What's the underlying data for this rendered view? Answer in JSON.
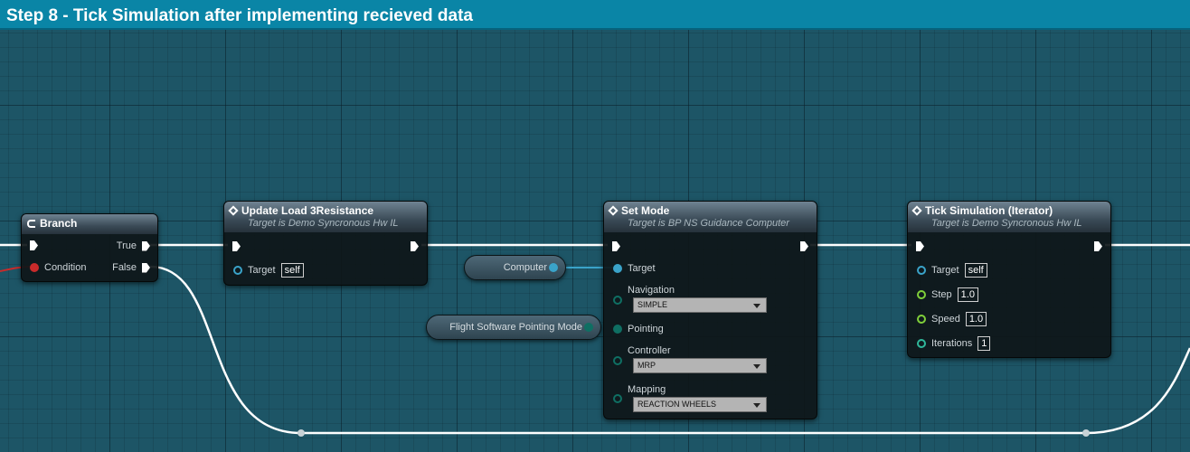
{
  "title": "Step 8 - Tick Simulation after implementing recieved data",
  "colors": {
    "title_bar": "#0a85a6",
    "canvas": "#1d5566",
    "exec_wire": "#ffffff",
    "object_pin": "#3aa3c9",
    "float_pin": "#7fcf3a",
    "int_pin": "#2fb79a",
    "bool_pin": "#c92b2b"
  },
  "branch": {
    "title": "Branch",
    "true_label": "True",
    "condition_label": "Condition",
    "false_label": "False",
    "icon": "branch-icon"
  },
  "update_load": {
    "title": "Update Load 3Resistance",
    "subtitle": "Target is Demo Syncronous Hw IL",
    "target_label": "Target",
    "target_value": "self",
    "icon": "function-icon"
  },
  "computer_var": {
    "label": "Computer"
  },
  "pointing_var": {
    "label": "Flight Software Pointing Mode"
  },
  "set_mode": {
    "title": "Set Mode",
    "subtitle": "Target is BP NS Guidance Computer",
    "icon": "function-icon",
    "target_label": "Target",
    "navigation_label": "Navigation",
    "navigation_value": "SIMPLE",
    "pointing_label": "Pointing",
    "controller_label": "Controller",
    "controller_value": "MRP",
    "mapping_label": "Mapping",
    "mapping_value": "REACTION WHEELS"
  },
  "tick_sim": {
    "title": "Tick Simulation (Iterator)",
    "subtitle": "Target is Demo Syncronous Hw IL",
    "icon": "function-icon",
    "target_label": "Target",
    "target_value": "self",
    "step_label": "Step",
    "step_value": "1.0",
    "speed_label": "Speed",
    "speed_value": "1.0",
    "iterations_label": "Iterations",
    "iterations_value": "1"
  }
}
